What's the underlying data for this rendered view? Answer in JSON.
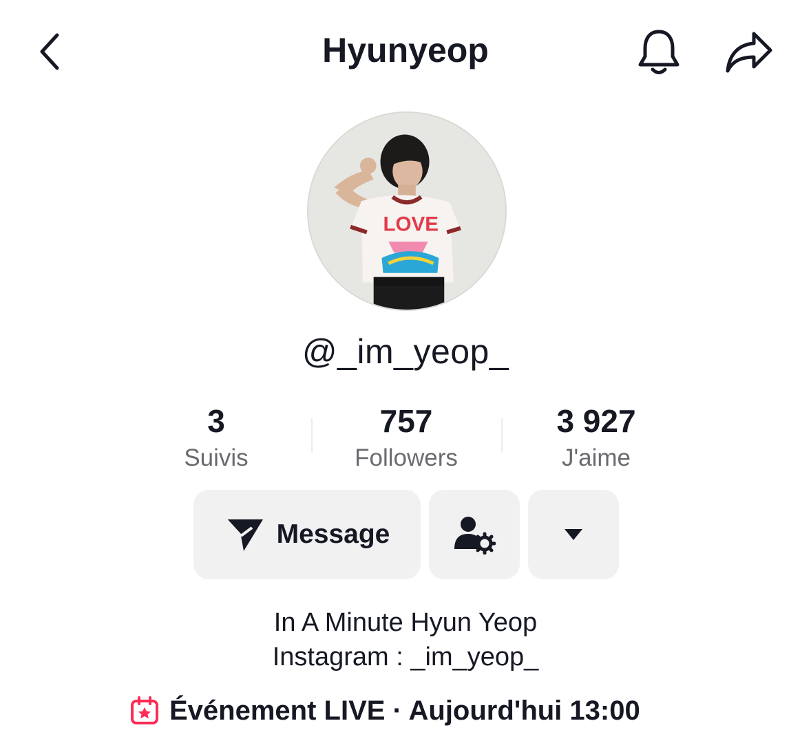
{
  "header": {
    "title": "Hyunyeop",
    "back_icon": "chevron-left-icon",
    "bell_icon": "bell-icon",
    "share_icon": "share-arrow-icon"
  },
  "profile": {
    "username": "@_im_yeop_",
    "avatar_icon": "profile-photo"
  },
  "stats": [
    {
      "value": "3",
      "label": "Suivis"
    },
    {
      "value": "757",
      "label": "Followers"
    },
    {
      "value": "3 927",
      "label": "J'aime"
    }
  ],
  "actions": {
    "message_label": "Message",
    "message_icon": "send-icon",
    "friends_icon": "user-settings-icon",
    "more_icon": "caret-down-icon"
  },
  "bio": {
    "line1": "In A Minute Hyun Yeop",
    "line2": "Instagram : _im_yeop_"
  },
  "event": {
    "text": "Événement LIVE · Aujourd'hui 13:00",
    "icon": "calendar-star-icon",
    "accent_color": "#fe2c55"
  }
}
